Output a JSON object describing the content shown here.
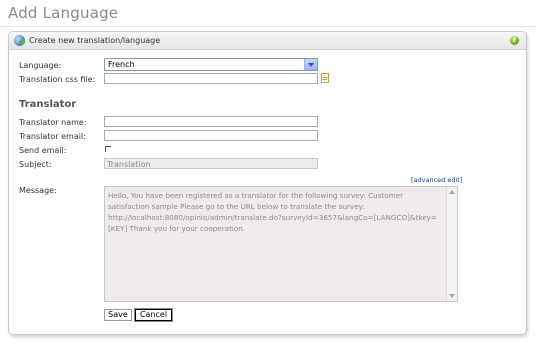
{
  "page": {
    "title": "Add Language"
  },
  "panel": {
    "title": "Create new translation/language",
    "help_icon": "help-icon",
    "header_icon": "translation-globe-icon"
  },
  "form": {
    "language": {
      "label": "Language:",
      "selected": "French"
    },
    "css_file": {
      "label": "Translation css file:",
      "value": "",
      "icon": "file-icon"
    },
    "translator_section": "Translator",
    "translator_name": {
      "label": "Translator name:",
      "value": ""
    },
    "translator_email": {
      "label": "Translator email:",
      "value": ""
    },
    "send_email": {
      "label": "Send email:",
      "checked": false
    },
    "subject": {
      "label": "Subject:",
      "value": "Translation"
    },
    "advanced_edit": "[advanced edit]",
    "message": {
      "label": "Message:",
      "value": "Hello, You have been registered as a translator for the following survey: Customer satisfaction sample Please go to the URL below to translate the survey: http://localhost:8080/opinio/admin/translate.do?surveyId=3657&langCo=[LANGCO]&tkey=[KEY] Thank you for your cooperation."
    }
  },
  "buttons": {
    "save": "Save",
    "cancel": "Cancel"
  }
}
